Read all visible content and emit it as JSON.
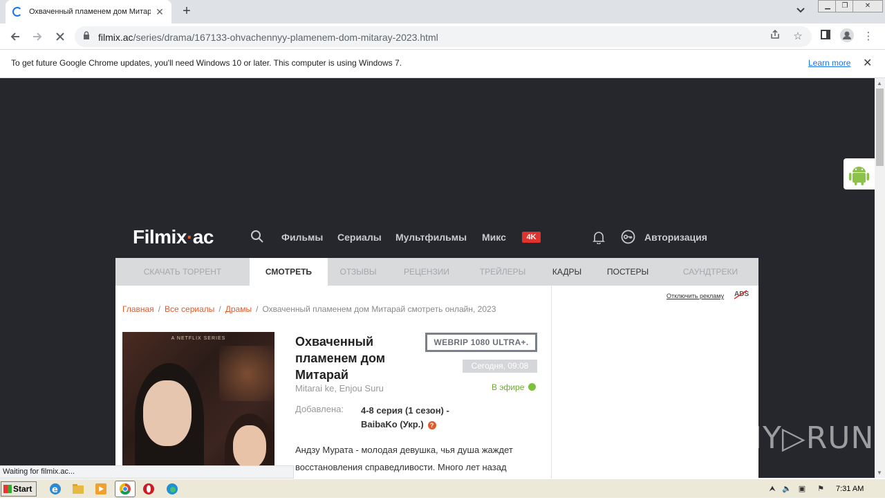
{
  "browser": {
    "tab_title": "Охваченный пламенем дом Митарай",
    "tab_close": "✕",
    "new_tab": "+",
    "url_host": "filmix.ac",
    "url_path": "/series/drama/167133-ohvachennyy-plamenem-dom-mitaray-2023.html",
    "infobar_message": "To get future Google Chrome updates, you'll need Windows 10 or later. This computer is using Windows 7.",
    "infobar_link": "Learn more",
    "status_text": "Waiting for filmix.ac..."
  },
  "site": {
    "logo_main": "Filmix",
    "logo_dot": "·",
    "logo_tld": "ac",
    "nav": [
      "Фильмы",
      "Сериалы",
      "Мультфильмы",
      "Микс"
    ],
    "badge_4k": "4K",
    "login": "Авторизация",
    "tabs": [
      "СКАЧАТЬ ТОРРЕНТ",
      "СМОТРЕТЬ",
      "ОТЗЫВЫ",
      "РЕЦЕНЗИИ",
      "ТРЕЙЛЕРЫ",
      "КАДРЫ",
      "ПОСТЕРЫ",
      "САУНДТРЕКИ"
    ],
    "active_tab": "СМОТРЕТЬ",
    "ads_off": "Отключить рекламу",
    "ads_mark": "ADS"
  },
  "breadcrumbs": {
    "home": "Главная",
    "all_series": "Все сериалы",
    "dramas": "Драмы",
    "current": "Охваченный пламенем дом Митарай смотреть онлайн, 2023",
    "sep": "/"
  },
  "movie": {
    "poster_tag": "A NETFLIX SERIES",
    "title": "Охваченный пламенем дом Митарай",
    "original_title": "Mitarai ke, Enjou Suru",
    "quality": "WEBRIP 1080 ULTRA+.",
    "date": "Сегодня, 09:08",
    "on_air": "В эфире",
    "added_label": "Добавлена:",
    "added_value": "4-8 серия (1 сезон) - BaibaKo (Укр.)",
    "help": "?",
    "description": "Андзу Мурата - молодая девушка, чья душа жаждет восстановления справедливости. Много лет назад"
  },
  "watermark": "ANY▷RUN",
  "taskbar": {
    "start": "Start",
    "clock": "7:31 AM"
  },
  "colors": {
    "page_bg": "#26272d",
    "accent": "#e05a2b",
    "badge_red": "#e0332e",
    "on_air_green": "#7cc13a"
  }
}
